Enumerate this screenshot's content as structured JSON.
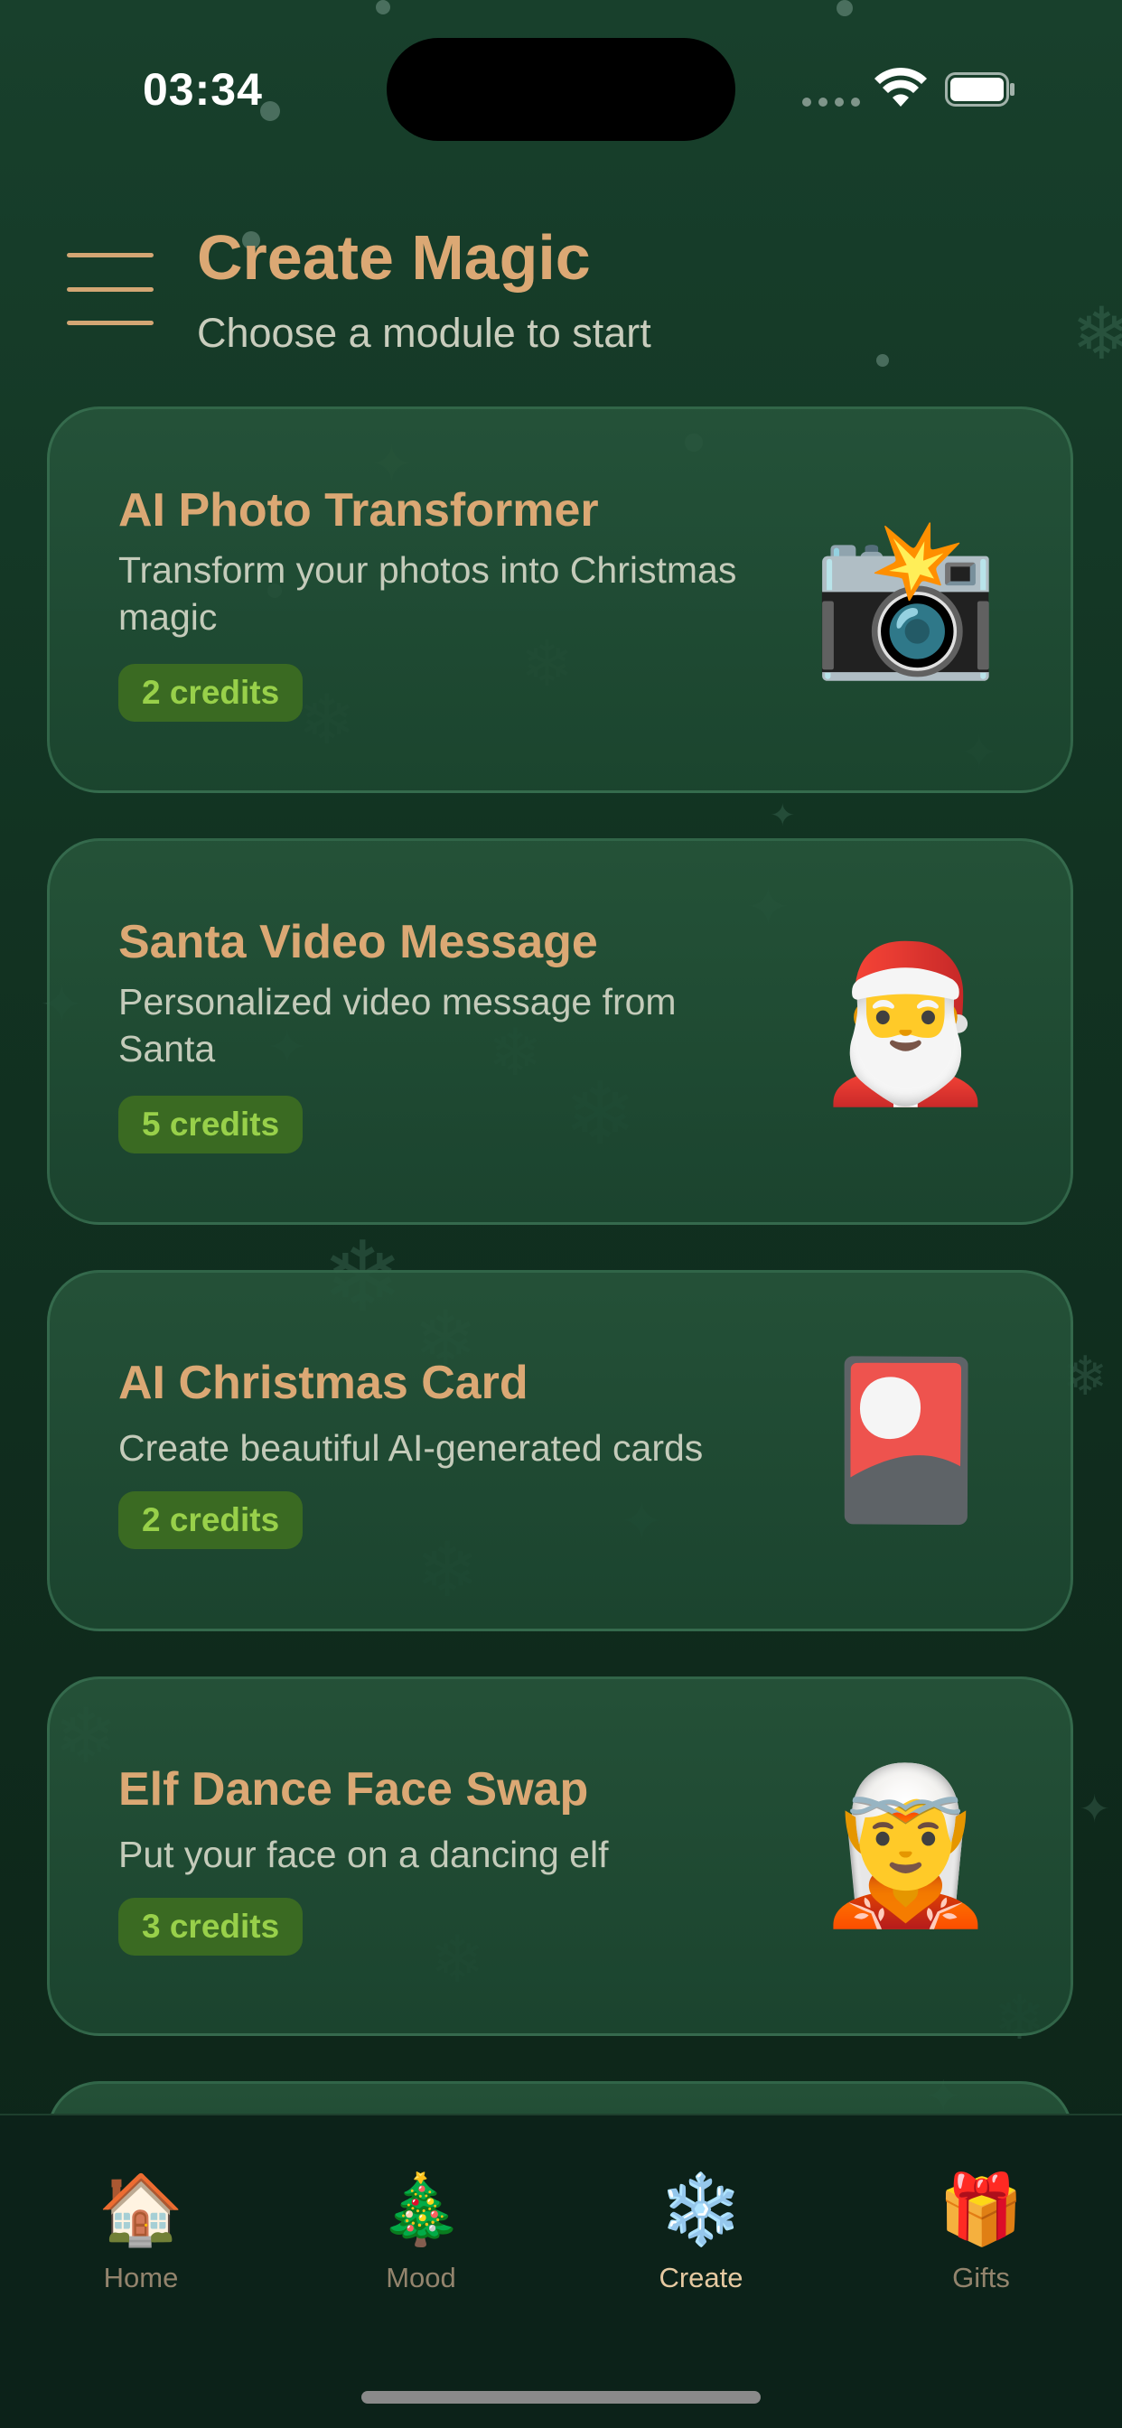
{
  "status_bar": {
    "time": "03:34"
  },
  "header": {
    "title": "Create Magic",
    "subtitle": "Choose a module to start"
  },
  "modules": [
    {
      "title": "AI Photo Transformer",
      "description": "Transform your photos into Christmas magic",
      "credits": "2 credits",
      "icon": "camera-with-flash-icon",
      "glyph": "📸"
    },
    {
      "title": "Santa Video Message",
      "description": "Personalized video message from Santa",
      "credits": "5 credits",
      "icon": "santa-icon",
      "glyph": "🎅"
    },
    {
      "title": "AI Christmas Card",
      "description": "Create beautiful AI-generated cards",
      "credits": "2 credits",
      "icon": "card-icon",
      "glyph": "🎴"
    },
    {
      "title": "Elf Dance Face Swap",
      "description": "Put your face on a dancing elf",
      "credits": "3 credits",
      "icon": "elf-icon",
      "glyph": "🧝"
    }
  ],
  "tabs": [
    {
      "label": "Home",
      "icon": "house-icon",
      "glyph": "🏠"
    },
    {
      "label": "Mood",
      "icon": "christmas-tree-icon",
      "glyph": "🎄"
    },
    {
      "label": "Create",
      "icon": "snowflake-icon",
      "glyph": "❄️",
      "active": true
    },
    {
      "label": "Gifts",
      "icon": "gift-icon",
      "glyph": "🎁"
    }
  ],
  "colors": {
    "accent": "#dba874",
    "badge_bg": "#3a6a22",
    "badge_text": "#98d04a",
    "background": "#123322"
  }
}
